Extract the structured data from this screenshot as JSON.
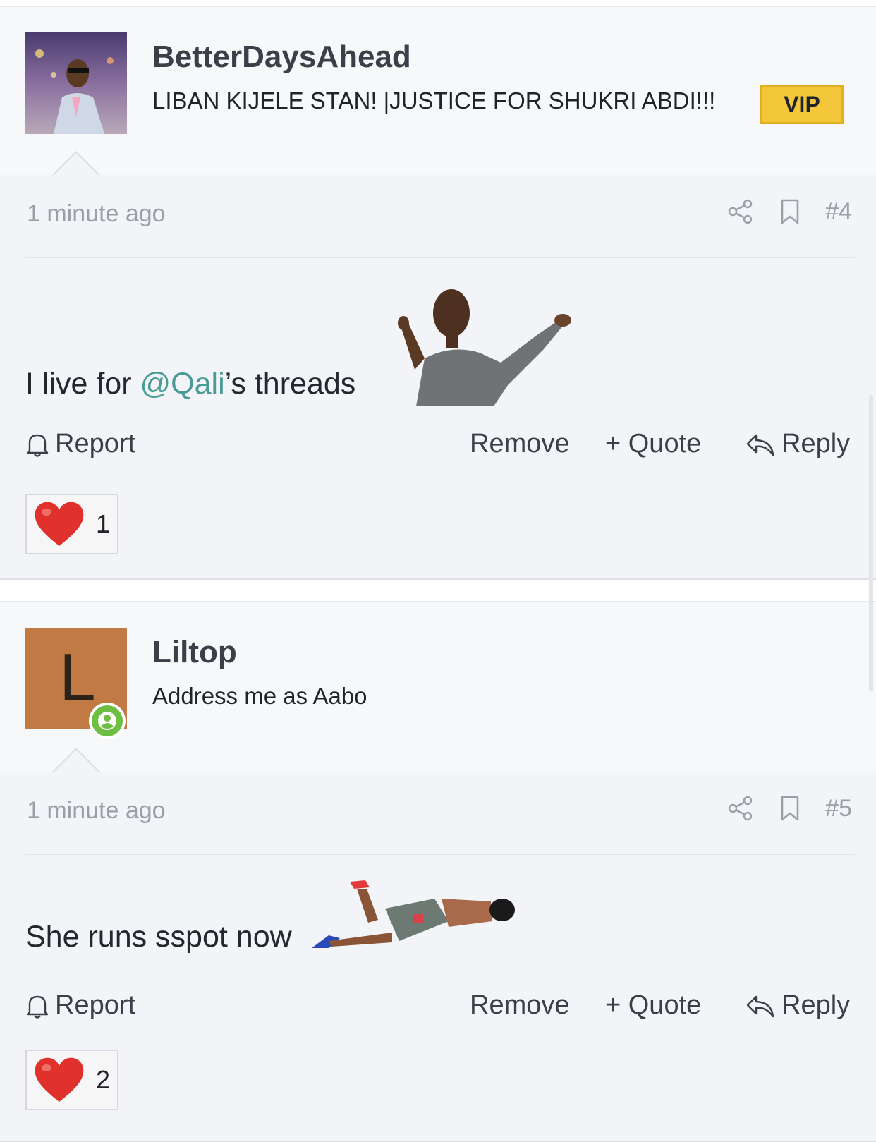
{
  "posts": [
    {
      "author": "BetterDaysAhead",
      "user_title": "LIBAN KIJELE STAN! |JUSTICE FOR SHUKRI ABDI!!!",
      "badge": "VIP",
      "avatar_type": "photo",
      "timestamp": "1 minute ago",
      "post_number": "#4",
      "content_before": "I live for ",
      "mention": "@Qali",
      "content_after": "’s threads",
      "reaction_count": "1"
    },
    {
      "author": "Liltop",
      "user_title": "Address me as Aabo",
      "avatar_letter": "L",
      "avatar_color": "#c27a45",
      "online": true,
      "timestamp": "1 minute ago",
      "post_number": "#5",
      "content": "She runs sspot now",
      "reaction_count": "2"
    }
  ],
  "actions": {
    "report": "Report",
    "remove": "Remove",
    "quote": "+ Quote",
    "reply": "Reply"
  },
  "icons": [
    "share-icon",
    "bookmark-icon",
    "bell-icon",
    "reply-arrow-icon",
    "heart-icon",
    "online-user-icon"
  ],
  "colors": {
    "mention": "#4a9a96",
    "vip_badge": "#f4c73b",
    "avatar_l": "#c27a45",
    "online_badge": "#6fbe44",
    "heart": "#e0312d"
  }
}
